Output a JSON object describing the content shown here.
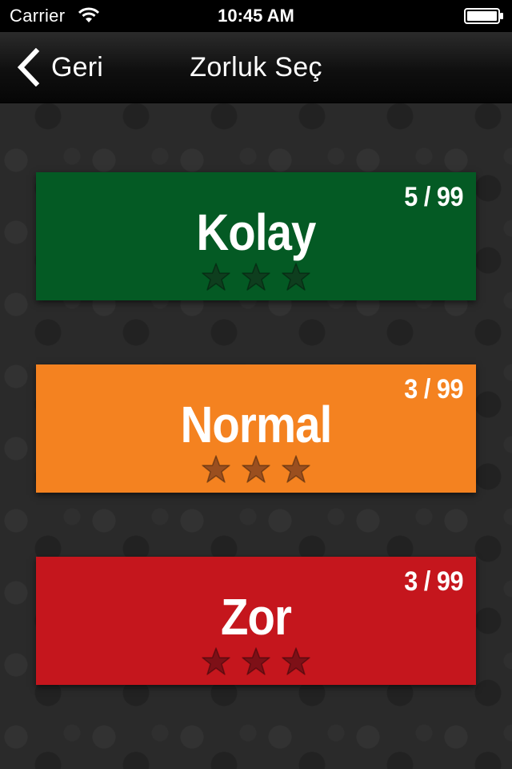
{
  "status_bar": {
    "carrier": "Carrier",
    "time": "10:45 AM",
    "wifi_icon": "wifi-icon",
    "battery_icon": "battery-full-icon"
  },
  "nav_bar": {
    "back_label": "Geri",
    "back_icon": "chevron-left-icon",
    "title": "Zorluk Seç"
  },
  "levels": [
    {
      "name": "Kolay",
      "count": "5 / 99",
      "stars_filled": 0,
      "stars_total": 3,
      "color": "#045a24",
      "star_color": "#0e3e1e"
    },
    {
      "name": "Normal",
      "count": "3 / 99",
      "stars_filled": 0,
      "stars_total": 3,
      "color": "#f48220",
      "star_color": "#9a4f1f"
    },
    {
      "name": "Zor",
      "count": "3 / 99",
      "stars_filled": 0,
      "stars_total": 3,
      "color": "#c5161d",
      "star_color": "#7e1017"
    }
  ]
}
